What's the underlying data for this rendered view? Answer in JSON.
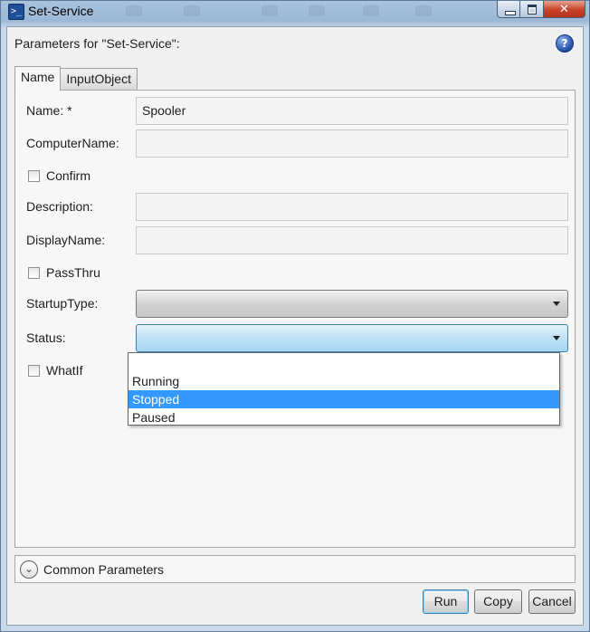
{
  "window": {
    "title": "Set-Service",
    "app_icon": "powershell-icon"
  },
  "dialog": {
    "heading": "Parameters for \"Set-Service\":",
    "help_icon": "?"
  },
  "tabs": [
    {
      "label": "Name",
      "active": true
    },
    {
      "label": "InputObject",
      "active": false
    }
  ],
  "fields": {
    "name": {
      "label": "Name: *",
      "value": "Spooler"
    },
    "computer_name": {
      "label": "ComputerName:",
      "value": ""
    },
    "confirm": {
      "label": "Confirm",
      "checked": false
    },
    "description": {
      "label": "Description:",
      "value": ""
    },
    "display_name": {
      "label": "DisplayName:",
      "value": ""
    },
    "pass_thru": {
      "label": "PassThru",
      "checked": false
    },
    "startup_type": {
      "label": "StartupType:",
      "value": ""
    },
    "status": {
      "label": "Status:",
      "value": "",
      "options": [
        "",
        "Running",
        "Stopped",
        "Paused"
      ],
      "highlighted": "Stopped"
    },
    "what_if": {
      "label": "WhatIf",
      "checked": false
    }
  },
  "common_parameters": {
    "label": "Common Parameters",
    "expanded": false
  },
  "buttons": {
    "run": "Run",
    "copy": "Copy",
    "cancel": "Cancel"
  },
  "colors": {
    "highlight": "#3399ff",
    "close_button": "#c7422a",
    "title_bar": "#9bb8d6"
  }
}
